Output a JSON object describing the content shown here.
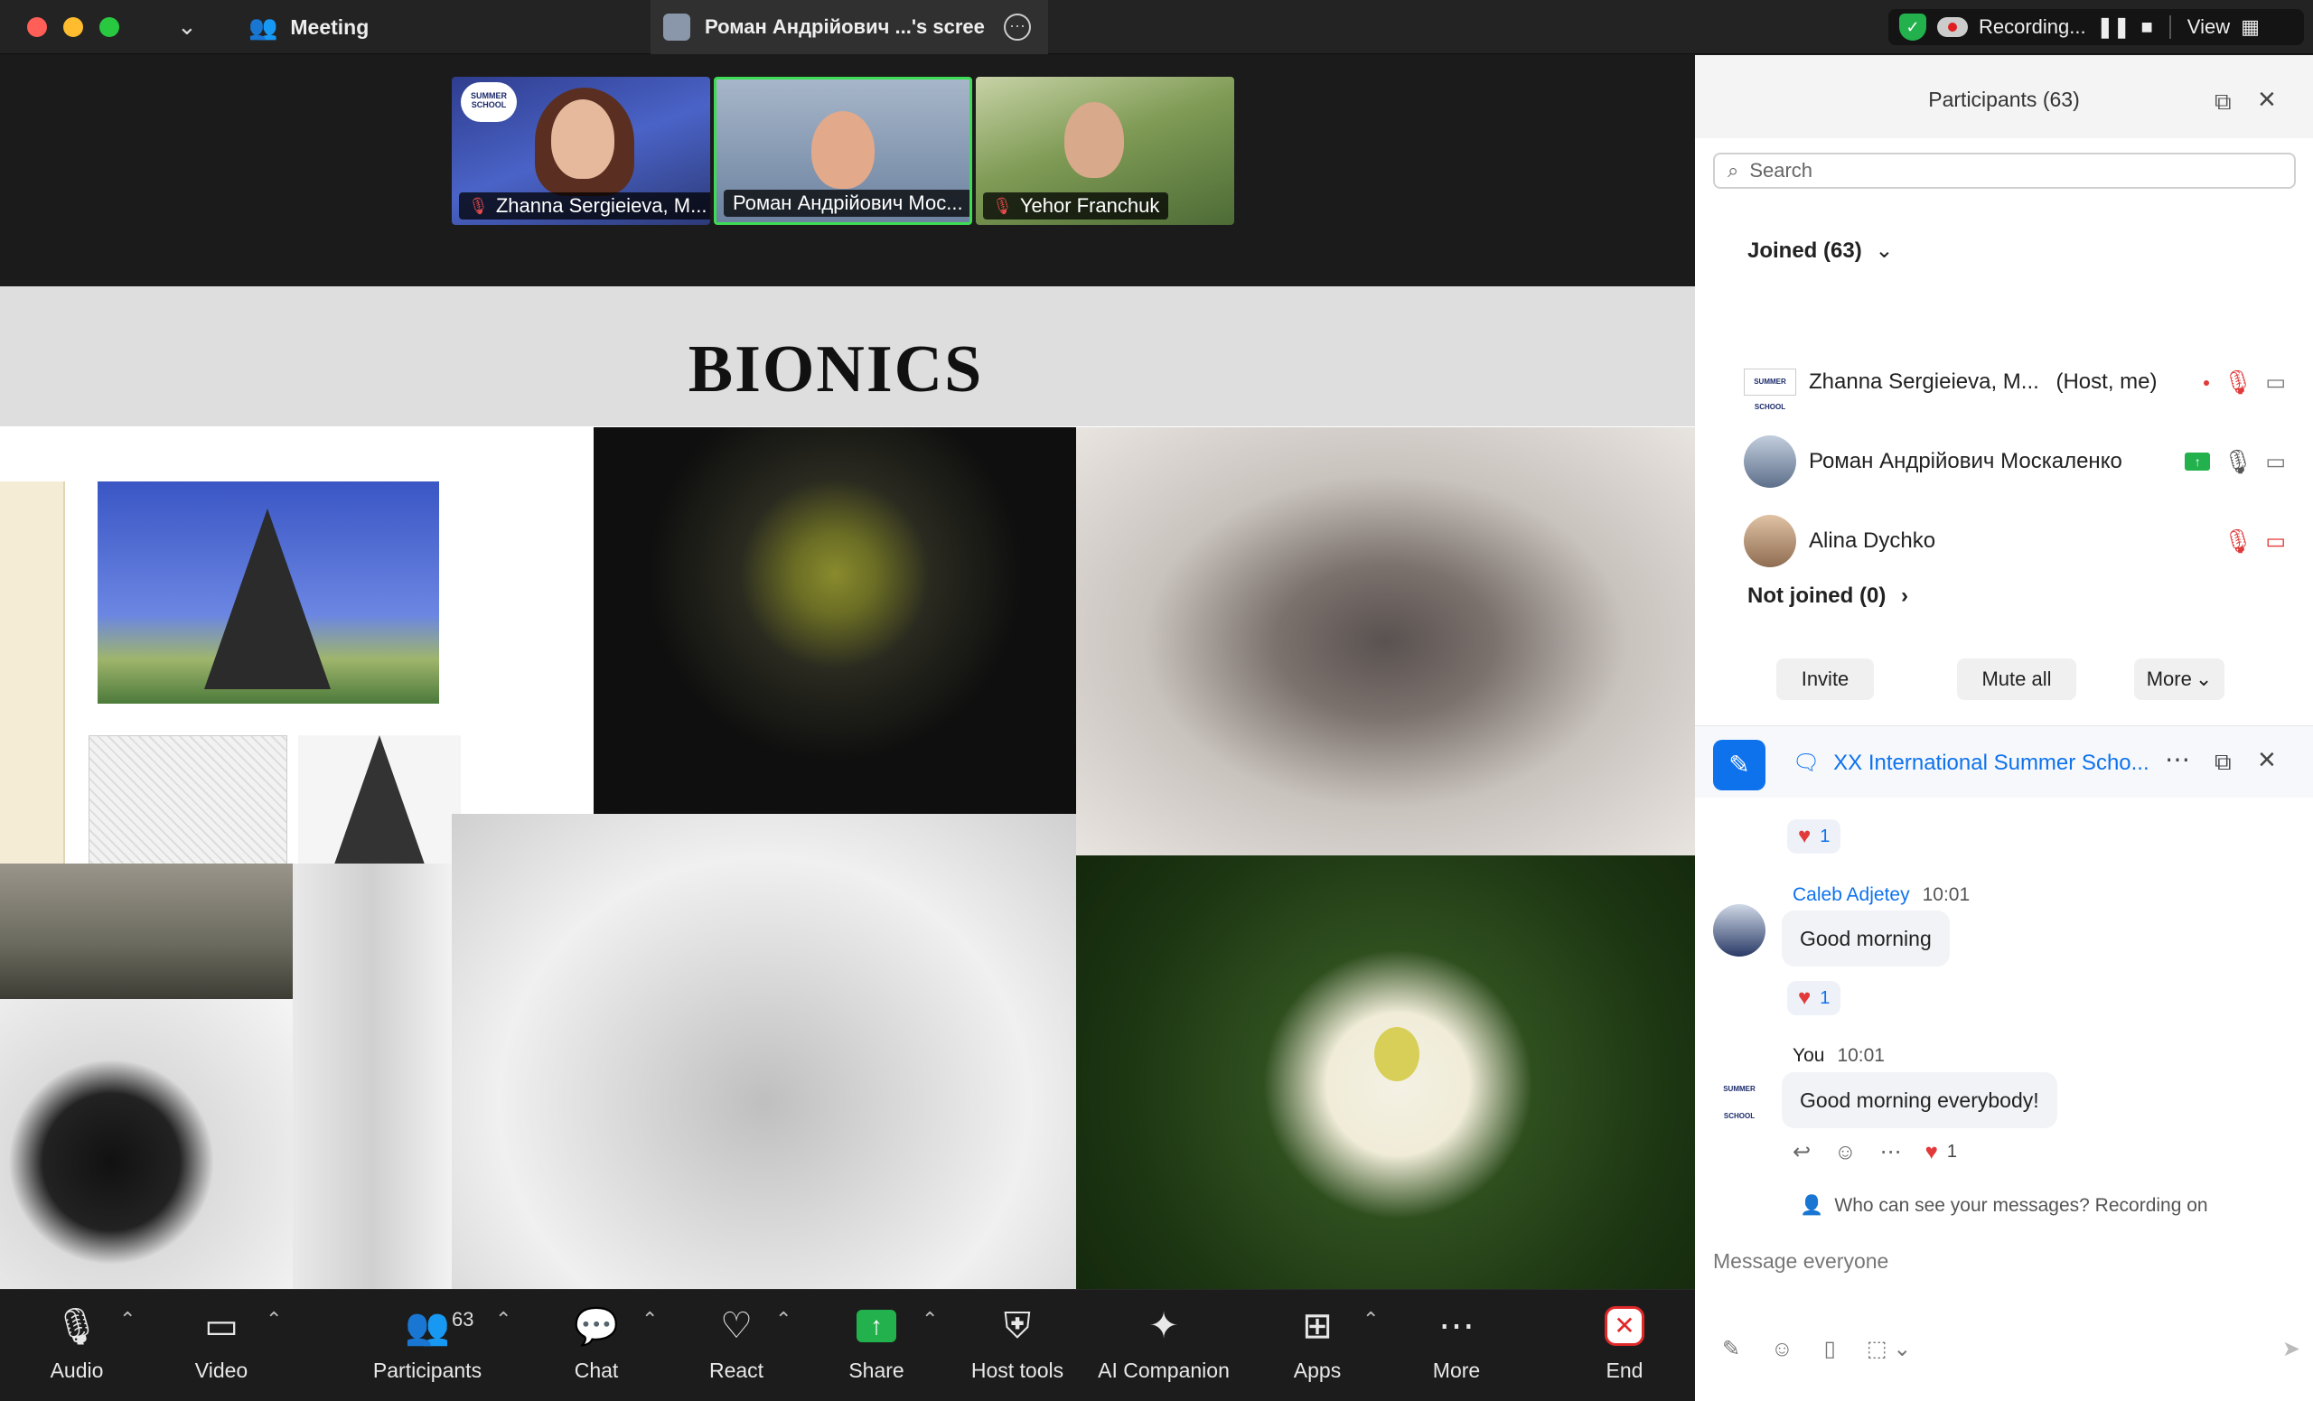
{
  "titlebar": {
    "meeting_label": "Meeting",
    "tab_title": "Роман Андрійович ...'s scree",
    "recording_label": "Recording...",
    "view_label": "View"
  },
  "thumbnails": [
    {
      "name": "Zhanna Sergieieva, M...",
      "muted": true
    },
    {
      "name": "Роман Андрійович Мос...",
      "muted": false
    },
    {
      "name": "Yehor Franchuk",
      "muted": true
    }
  ],
  "slide": {
    "title": "BIONICS",
    "logo_text": "SUMMER SCHOOL"
  },
  "toolbar": {
    "audio": "Audio",
    "video": "Video",
    "participants": "Participants",
    "participants_count": "63",
    "chat": "Chat",
    "react": "React",
    "share": "Share",
    "host_tools": "Host tools",
    "ai_companion": "AI Companion",
    "apps": "Apps",
    "more": "More",
    "end": "End"
  },
  "participants_panel": {
    "title": "Participants (63)",
    "search_placeholder": "Search",
    "joined_label": "Joined (63)",
    "rows": [
      {
        "name": "Zhanna Sergieieva, M...",
        "tag": "(Host, me)"
      },
      {
        "name": "Роман Андрійович Москаленко",
        "tag": ""
      },
      {
        "name": "Alina Dychko",
        "tag": ""
      }
    ],
    "not_joined_label": "Not joined (0)",
    "invite": "Invite",
    "mute_all": "Mute all",
    "more": "More"
  },
  "chat_panel": {
    "channel": "XX International Summer Scho...",
    "messages": [
      {
        "sender": "Caleb Adjetey",
        "time": "10:01",
        "text": "Good morning",
        "reaction_count": "1"
      },
      {
        "sender": "You",
        "time": "10:01",
        "text": "Good morning everybody!",
        "reaction_count": "1"
      }
    ],
    "prev_reaction_count": "1",
    "visibility_note": "Who can see your messages? Recording on",
    "input_placeholder": "Message everyone"
  },
  "colors": {
    "accent": "#0e72ed",
    "share_green": "#22b14c",
    "end_red": "#e02828",
    "muted_red": "#e03a3a"
  }
}
